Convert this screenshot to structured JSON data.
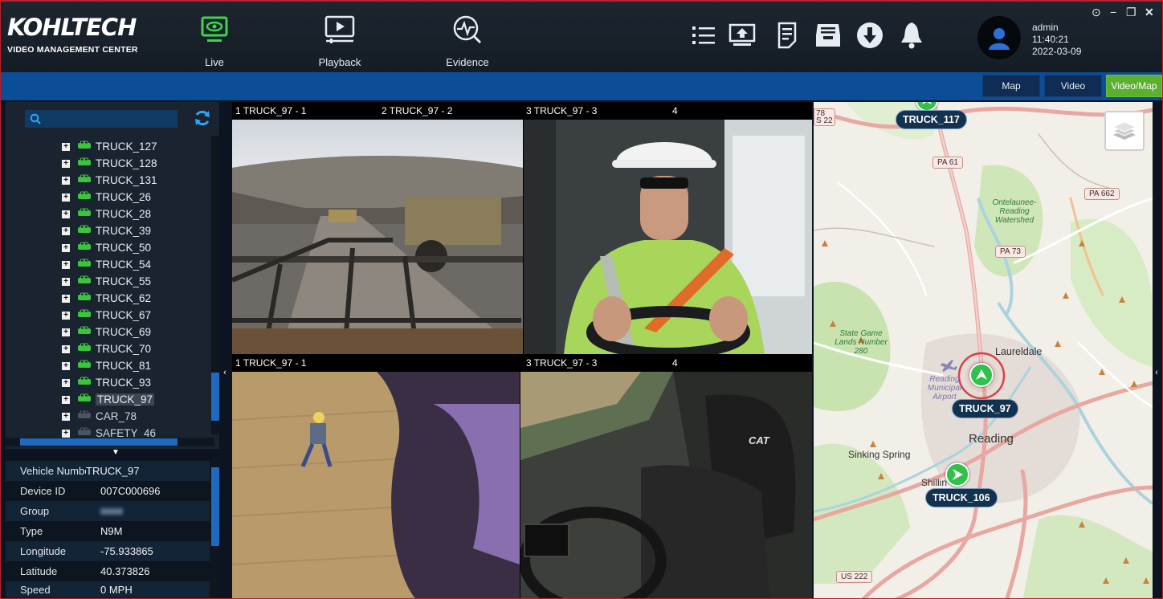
{
  "brand": {
    "name": "KOHLTECH",
    "subtitle": "VIDEO MANAGEMENT CENTER"
  },
  "modes": [
    {
      "label": "Live",
      "icon": "monitor-eye-icon",
      "active": true
    },
    {
      "label": "Playback",
      "icon": "playback-icon"
    },
    {
      "label": "Evidence",
      "icon": "evidence-icon"
    }
  ],
  "toolbar": [
    "list-icon",
    "upload-icon",
    "document-icon",
    "inbox-icon",
    "download-icon",
    "bell-icon"
  ],
  "user": {
    "name": "admin",
    "time": "11:40:21",
    "date": "2022-03-09"
  },
  "window_controls": [
    "settings-icon",
    "minimize-icon",
    "restore-icon",
    "close-icon"
  ],
  "view_buttons": {
    "map": "Map",
    "video": "Video",
    "video_map": "Video/Map"
  },
  "tree": {
    "search_placeholder": "",
    "items": [
      {
        "label": "TRUCK_127"
      },
      {
        "label": "TRUCK_128"
      },
      {
        "label": "TRUCK_131"
      },
      {
        "label": "TRUCK_26"
      },
      {
        "label": "TRUCK_28"
      },
      {
        "label": "TRUCK_39"
      },
      {
        "label": "TRUCK_50"
      },
      {
        "label": "TRUCK_54"
      },
      {
        "label": "TRUCK_55"
      },
      {
        "label": "TRUCK_62"
      },
      {
        "label": "TRUCK_67"
      },
      {
        "label": "TRUCK_69"
      },
      {
        "label": "TRUCK_70"
      },
      {
        "label": "TRUCK_81"
      },
      {
        "label": "TRUCK_93"
      },
      {
        "label": "TRUCK_97",
        "selected": true
      },
      {
        "label": "CAR_78",
        "offline": true
      },
      {
        "label": "SAFETY_46",
        "offline": true
      }
    ]
  },
  "info": {
    "rows": [
      {
        "key": "Vehicle Numbe",
        "value": "TRUCK_97"
      },
      {
        "key": "Device ID",
        "value": "007C000696"
      },
      {
        "key": "Group",
        "value": ""
      },
      {
        "key": "Type",
        "value": "N9M"
      },
      {
        "key": "Longitude",
        "value": "-75.933865"
      },
      {
        "key": "Latitude",
        "value": "40.373826"
      },
      {
        "key": "Speed",
        "value": "0 MPH"
      }
    ]
  },
  "videos": {
    "top": [
      {
        "title": "1 TRUCK_97 - 1"
      },
      {
        "title": "2 TRUCK_97 - 2"
      },
      {
        "title": "3 TRUCK_97 - 3"
      },
      {
        "title": "4"
      }
    ],
    "bottom": [
      {
        "title": "1 TRUCK_97 - 1"
      },
      {
        "title": "3 TRUCK_97 - 3"
      },
      {
        "title": "4"
      }
    ],
    "cat_badge": "CAT"
  },
  "map": {
    "trucks": [
      {
        "label": "TRUCK_117"
      },
      {
        "label": "TRUCK_97"
      },
      {
        "label": "TRUCK_106"
      }
    ],
    "places": {
      "laureldale": "Laureldale",
      "reading": "Reading",
      "sinking_spring": "Sinking Spring",
      "shillington": "Shillin",
      "airport": "Reading\nMunicipal\nAirport",
      "watershed": "Ontelaunee-\nReading\nWatershed",
      "gamelands": "State Game\nLands Number\n280"
    },
    "roads": {
      "pa61": "PA 61",
      "pa662": "PA 662",
      "pa73": "PA 73",
      "us222": "US 222",
      "r78": "78",
      "r22": "S 22"
    },
    "colors": {
      "marker": "#2fc14a",
      "tag": "#12324f",
      "selected_ring": "#d8262e"
    }
  }
}
